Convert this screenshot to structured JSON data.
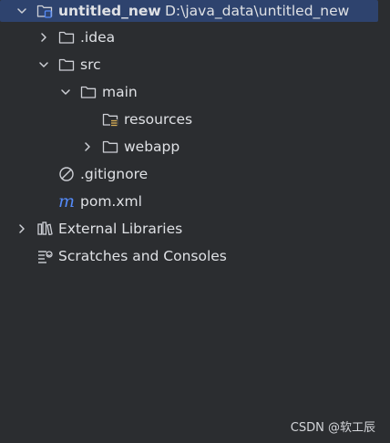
{
  "tree": {
    "root": {
      "name": "untitled_new",
      "path": "D:\\java_data\\untitled_new",
      "expanded": true,
      "selected": true
    },
    "items": [
      {
        "label": ".idea",
        "expanded": false
      },
      {
        "label": "src",
        "expanded": true
      },
      {
        "label": "main",
        "expanded": true
      },
      {
        "label": "resources"
      },
      {
        "label": "webapp",
        "expanded": false
      },
      {
        "label": ".gitignore"
      },
      {
        "label": "pom.xml"
      },
      {
        "label": "External Libraries",
        "expanded": false
      },
      {
        "label": "Scratches and Consoles"
      }
    ]
  },
  "icons": {
    "folder": "folder-icon",
    "module": "module-folder-icon",
    "resources": "resources-folder-icon",
    "ignore": "gitignore-icon",
    "maven": "maven-pom-icon",
    "libraries": "libraries-icon",
    "scratches": "scratches-icon"
  },
  "colors": {
    "background": "#2b2d30",
    "selection": "#2e436e",
    "text": "#dfe1e5",
    "icon_stroke": "#ced0d6",
    "maven_accent": "#548af7",
    "resources_accent": "#d6ae58"
  },
  "watermark": "CSDN @软工辰"
}
